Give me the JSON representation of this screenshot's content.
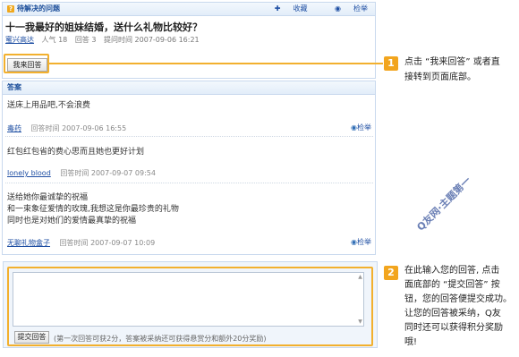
{
  "question_panel": {
    "header_label": "待解决的问题",
    "fav_label": "收藏",
    "report_label": "检举",
    "title": "十一我最好的姐妹结婚，送什么礼物比较好？",
    "asker": "蜜兴高达",
    "popularity": "人气 18",
    "answers": "回答 3",
    "ask_time": "提问时间 2007-09-06 16:21",
    "answer_button": "我来回答"
  },
  "answers_panel": {
    "header_label": "答案",
    "items": [
      {
        "text": "送床上用品吧,不会浪费",
        "user": "毒药",
        "time": "回答时间 2007-09-06 16:55",
        "report": "检举"
      },
      {
        "text": "红包红包省的费心思而且她也更好计划",
        "user": "lonely blood",
        "time": "回答时间 2007-09-07 09:54",
        "report": ""
      },
      {
        "lines": [
          "送给她你最诚挚的祝福",
          "和一束象征爱情的玫瑰,我想这是你最珍贵的礼物",
          "同时也是对她们的爱情最真挚的祝福"
        ],
        "user": "无聊礼物盒子",
        "time": "回答时间 2007-09-07 10:09",
        "report": "检举"
      }
    ]
  },
  "input_panel": {
    "input_value": "",
    "submit_label": "提交回答",
    "hint": "(第一次回答可获2分，答案被采纳还可获得悬赏分和额外20分奖励)"
  },
  "callouts": {
    "one": {
      "number": "1",
      "line1": "点击 “我来回答” 或者直",
      "line2": "接转到页面底部。"
    },
    "two": {
      "number": "2",
      "lines": [
        "在此输入您的回答, 点击",
        "面底部的 “提交回答” 按",
        "钮，您的回答便提交成功。",
        "让您的回答被采纳，Q友",
        "同时还可以获得积分奖励",
        "哦!"
      ]
    }
  },
  "watermark": "Q友网·主题第一"
}
